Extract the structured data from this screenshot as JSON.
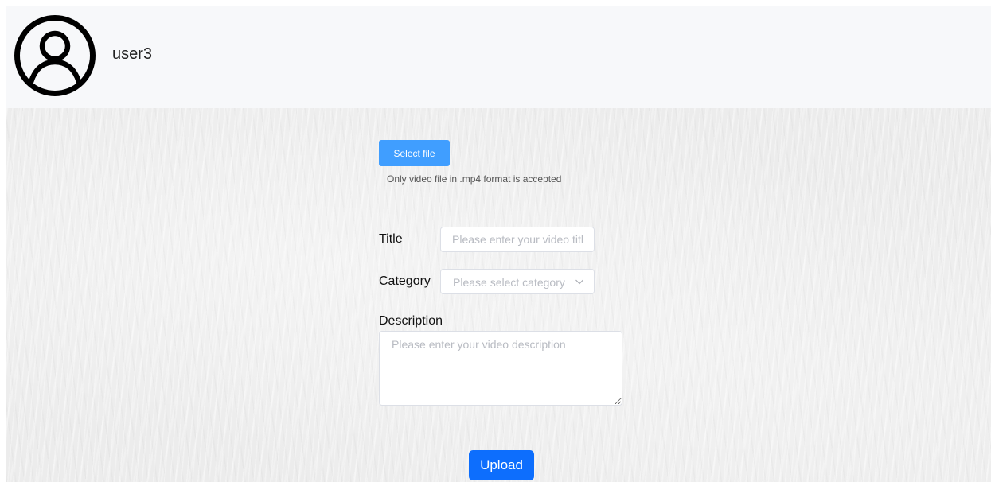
{
  "header": {
    "avatar_icon": "user-circle-icon",
    "username": "user3"
  },
  "upload_form": {
    "select_file_label": "Select file",
    "file_hint": "Only video file in .mp4 format is accepted",
    "title_label": "Title",
    "title_placeholder": "Please enter your video title",
    "category_label": "Category",
    "category_placeholder": "Please select category",
    "description_label": "Description",
    "description_placeholder": "Please enter your video description",
    "upload_label": "Upload"
  },
  "colors": {
    "select_file_button": "#409eff",
    "upload_button": "#0d6efd",
    "header_background": "#f7f8fa"
  }
}
